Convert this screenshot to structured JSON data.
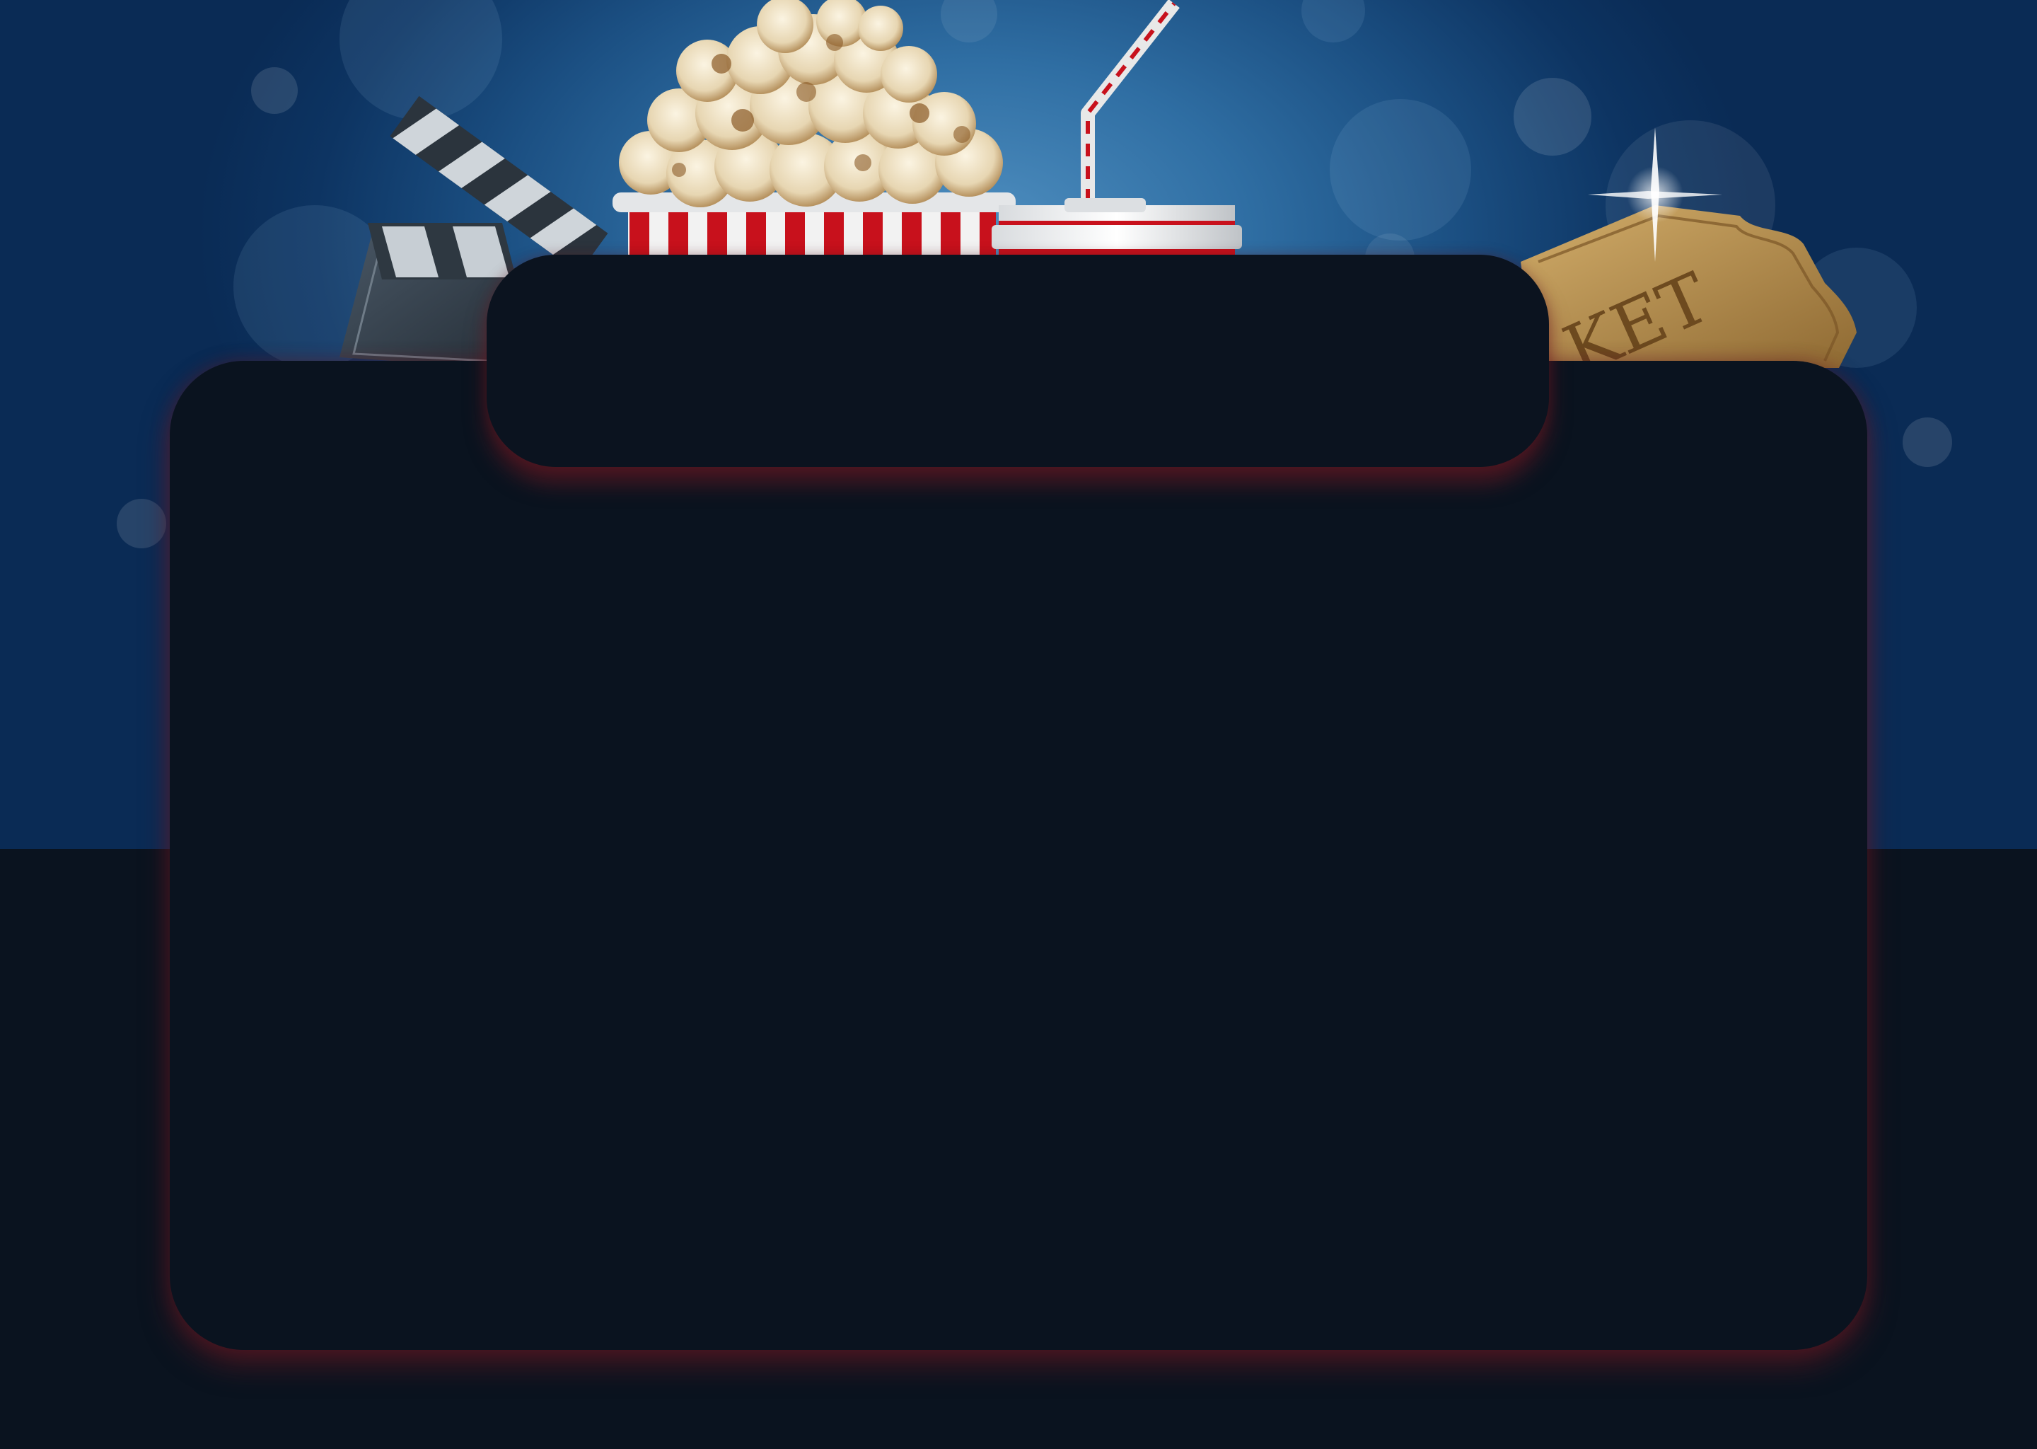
{
  "scene": {
    "ticket_text": "KET",
    "colors": {
      "sky_light": "#4f8fc0",
      "sky_dark": "#0a2b55",
      "panel": "#0a131f",
      "panel_glow": "#6e1923",
      "popcorn_red": "#c8111c",
      "ticket_gold": "#b58a45"
    },
    "icons": [
      "clapperboard-icon",
      "popcorn-icon",
      "soda-cup-icon",
      "ticket-icon"
    ]
  }
}
